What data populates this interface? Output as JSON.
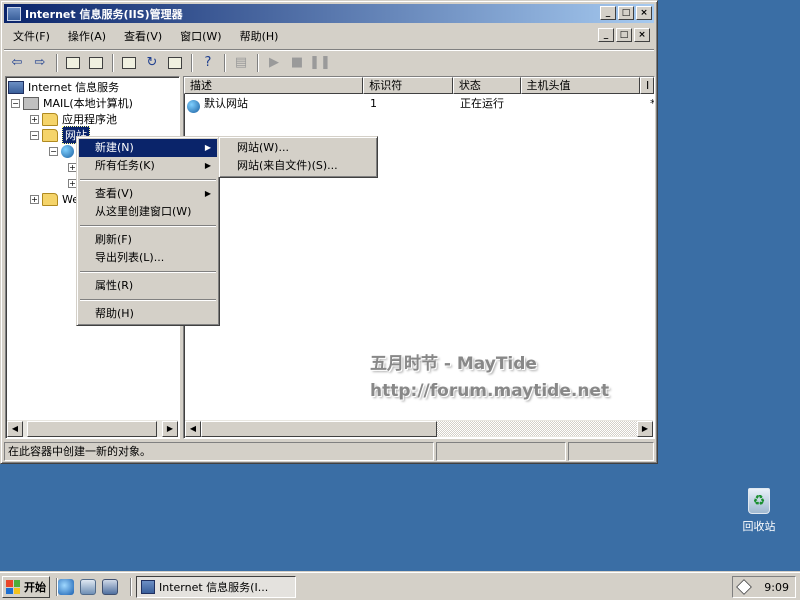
{
  "window": {
    "title": "Internet 信息服务(IIS)管理器",
    "minimize_glyph": "_",
    "maximize_glyph": "□",
    "close_glyph": "×"
  },
  "menubar": {
    "items": [
      "文件(F)",
      "操作(A)",
      "查看(V)",
      "窗口(W)",
      "帮助(H)"
    ]
  },
  "toolbar": {
    "buttons": [
      "back-icon",
      "forward-icon",
      "up-folder-icon",
      "show-tree-icon",
      "properties-icon",
      "refresh-icon",
      "export-icon",
      "help-icon",
      "computer-icon",
      "play-icon",
      "stop-icon",
      "pause-icon"
    ]
  },
  "tree": {
    "root": "Internet 信息服务",
    "computer": "MAIL(本地计算机)",
    "app_pools": "应用程序池",
    "websites": "网站",
    "web_ext_truncated": "We"
  },
  "list": {
    "columns": [
      "描述",
      "标识符",
      "状态",
      "主机头值",
      "I"
    ],
    "rows": [
      {
        "description": "默认网站",
        "id": "1",
        "status": "正在运行",
        "host_header": "",
        "extra": "*"
      }
    ]
  },
  "context_menu": {
    "items": [
      {
        "label": "新建(N)",
        "submenu": true,
        "highlighted": true
      },
      {
        "label": "所有任务(K)",
        "submenu": true
      },
      {
        "separator": true
      },
      {
        "label": "查看(V)",
        "submenu": true
      },
      {
        "label": "从这里创建窗口(W)"
      },
      {
        "separator": true
      },
      {
        "label": "刷新(F)"
      },
      {
        "label": "导出列表(L)..."
      },
      {
        "separator": true
      },
      {
        "label": "属性(R)"
      },
      {
        "separator": true
      },
      {
        "label": "帮助(H)"
      }
    ]
  },
  "submenu": {
    "items": [
      "网站(W)...",
      "网站(来自文件)(S)..."
    ]
  },
  "status_bar": {
    "text": "在此容器中创建一新的对象。"
  },
  "watermark": {
    "line1": "五月时节 - MayTide",
    "line2": "http://forum.maytide.net"
  },
  "desktop": {
    "recycle_bin_label": "回收站"
  },
  "taskbar": {
    "start_label": "开始",
    "task_label": "Internet 信息服务(I...",
    "clock": "9:09"
  },
  "colors": {
    "desktop": "#3a6ea5",
    "face": "#d4d0c8",
    "selection": "#0a246a",
    "title_gradient_start": "#0a246a",
    "title_gradient_end": "#a6caf0"
  }
}
